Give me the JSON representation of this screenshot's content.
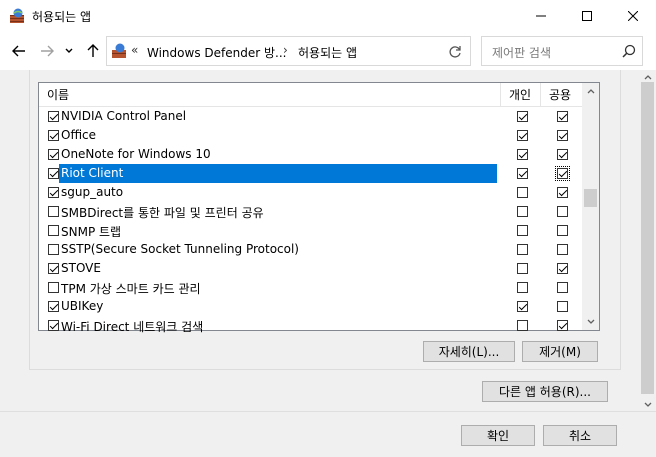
{
  "window": {
    "title": "허용되는 앱",
    "icon": "firewall-icon"
  },
  "address": {
    "overflow_chevron": "«",
    "segments": [
      "Windows Defender 방...",
      "허용되는 앱"
    ],
    "separator": "›"
  },
  "search": {
    "placeholder": "제어판 검색"
  },
  "list": {
    "columns": {
      "name": "이름",
      "private": "개인",
      "public": "공용"
    },
    "rows": [
      {
        "name": "NVIDIA Control Panel",
        "enabled": true,
        "private": true,
        "public": true
      },
      {
        "name": "Office",
        "enabled": true,
        "private": true,
        "public": true
      },
      {
        "name": "OneNote for Windows 10",
        "enabled": true,
        "private": true,
        "public": true
      },
      {
        "name": "Riot Client",
        "enabled": true,
        "private": true,
        "public": true,
        "selected": true
      },
      {
        "name": "sgup_auto",
        "enabled": true,
        "private": false,
        "public": true
      },
      {
        "name": "SMBDirect를 통한 파일 및 프린터 공유",
        "enabled": false,
        "private": false,
        "public": false
      },
      {
        "name": "SNMP 트랩",
        "enabled": false,
        "private": false,
        "public": false
      },
      {
        "name": "SSTP(Secure Socket Tunneling Protocol)",
        "enabled": false,
        "private": false,
        "public": false
      },
      {
        "name": "STOVE",
        "enabled": true,
        "private": false,
        "public": true
      },
      {
        "name": "TPM 가상 스마트 카드 관리",
        "enabled": false,
        "private": false,
        "public": false
      },
      {
        "name": "UBIKey",
        "enabled": true,
        "private": true,
        "public": false
      },
      {
        "name": "Wi-Fi Direct 네트워크 검색",
        "enabled": true,
        "private": false,
        "public": true
      }
    ]
  },
  "buttons": {
    "details": "자세히(L)...",
    "remove": "제거(M)",
    "allow_other": "다른 앱 허용(R)...",
    "ok": "확인",
    "cancel": "취소"
  },
  "colors": {
    "selection": "#0078d7",
    "button_face": "#e1e1e1",
    "panel": "#f0f0f0"
  }
}
